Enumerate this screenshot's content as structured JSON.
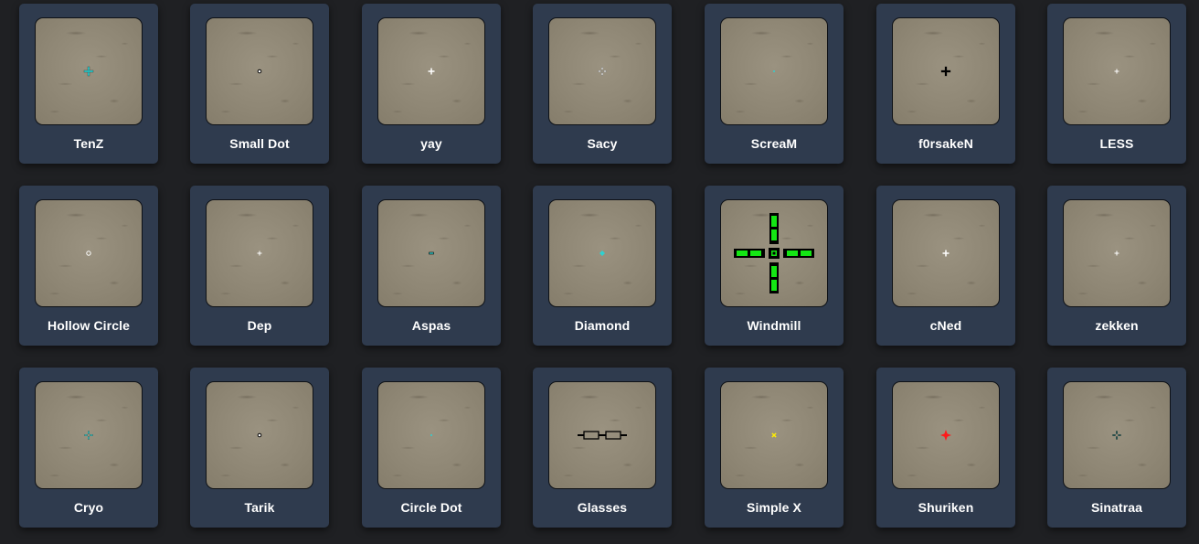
{
  "crosshairs": [
    {
      "name": "TenZ",
      "shape": "cross-outline",
      "color": "#2fd1d1"
    },
    {
      "name": "Small Dot",
      "shape": "dot-outlined",
      "color": "#ffffff"
    },
    {
      "name": "yay",
      "shape": "plus",
      "color": "#ffffff"
    },
    {
      "name": "Sacy",
      "shape": "cross-gap",
      "color": "#ffffff"
    },
    {
      "name": "ScreaM",
      "shape": "tiny-dot",
      "color": "#2fd1d1"
    },
    {
      "name": "f0rsakeN",
      "shape": "cross-outline",
      "color": "#000000"
    },
    {
      "name": "LESS",
      "shape": "tiny-plus",
      "color": "#ffffff"
    },
    {
      "name": "Hollow Circle",
      "shape": "circle",
      "color": "#ffffff"
    },
    {
      "name": "Dep",
      "shape": "tiny-plus",
      "color": "#ffffff"
    },
    {
      "name": "Aspas",
      "shape": "dash",
      "color": "#2fd1d1"
    },
    {
      "name": "Diamond",
      "shape": "diamond",
      "color": "#2fd1d1"
    },
    {
      "name": "Windmill",
      "shape": "windmill",
      "color": "#14e614"
    },
    {
      "name": "cNed",
      "shape": "plus",
      "color": "#ffffff"
    },
    {
      "name": "zekken",
      "shape": "tiny-plus",
      "color": "#ffffff"
    },
    {
      "name": "Cryo",
      "shape": "cross-gap",
      "color": "#2fd1d1"
    },
    {
      "name": "Tarik",
      "shape": "dot-outlined",
      "color": "#ffffff"
    },
    {
      "name": "Circle Dot",
      "shape": "tiny-dot",
      "color": "#2fd1d1"
    },
    {
      "name": "Glasses",
      "shape": "glasses",
      "color": "#000000"
    },
    {
      "name": "Simple X",
      "shape": "tiny-x",
      "color": "#ffee00"
    },
    {
      "name": "Shuriken",
      "shape": "shuriken",
      "color": "#ff1a1a"
    },
    {
      "name": "Sinatraa",
      "shape": "cross-gap",
      "color": "#1c5c5c"
    }
  ]
}
